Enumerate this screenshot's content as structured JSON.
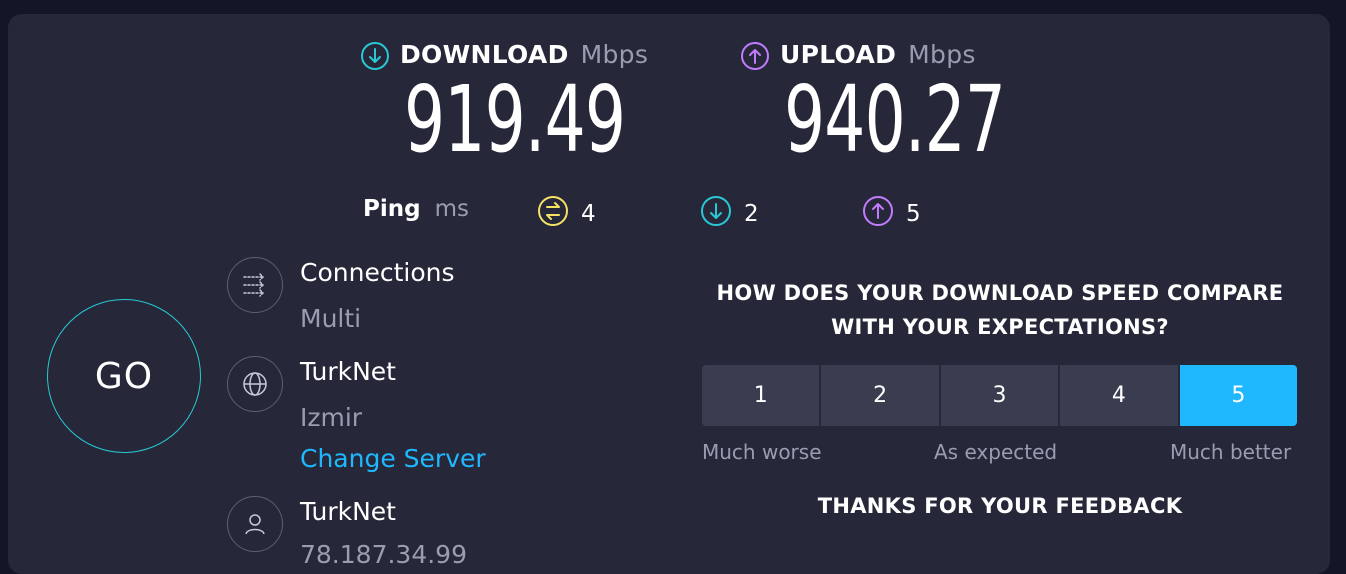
{
  "download": {
    "label": "DOWNLOAD",
    "unit": "Mbps",
    "value": "919.49",
    "color": "#28c9d4"
  },
  "upload": {
    "label": "UPLOAD",
    "unit": "Mbps",
    "value": "940.27",
    "color": "#c27bff"
  },
  "ping": {
    "label": "Ping",
    "unit": "ms",
    "idle": "4",
    "download": "2",
    "upload": "5",
    "idle_color": "#f4e265"
  },
  "go_label": "GO",
  "connections": {
    "title": "Connections",
    "value": "Multi"
  },
  "server": {
    "name": "TurkNet",
    "location": "Izmir",
    "change_label": "Change Server"
  },
  "provider": {
    "name": "TurkNet",
    "ip": "78.187.34.99"
  },
  "feedback": {
    "question_line1": "HOW DOES YOUR DOWNLOAD SPEED COMPARE",
    "question_line2": "WITH YOUR EXPECTATIONS?",
    "ratings": [
      "1",
      "2",
      "3",
      "4",
      "5"
    ],
    "selected_rating": "5",
    "low_label": "Much worse",
    "mid_label": "As expected",
    "high_label": "Much better",
    "thanks": "THANKS FOR YOUR FEEDBACK"
  },
  "accent_color": "#1fb8ff"
}
